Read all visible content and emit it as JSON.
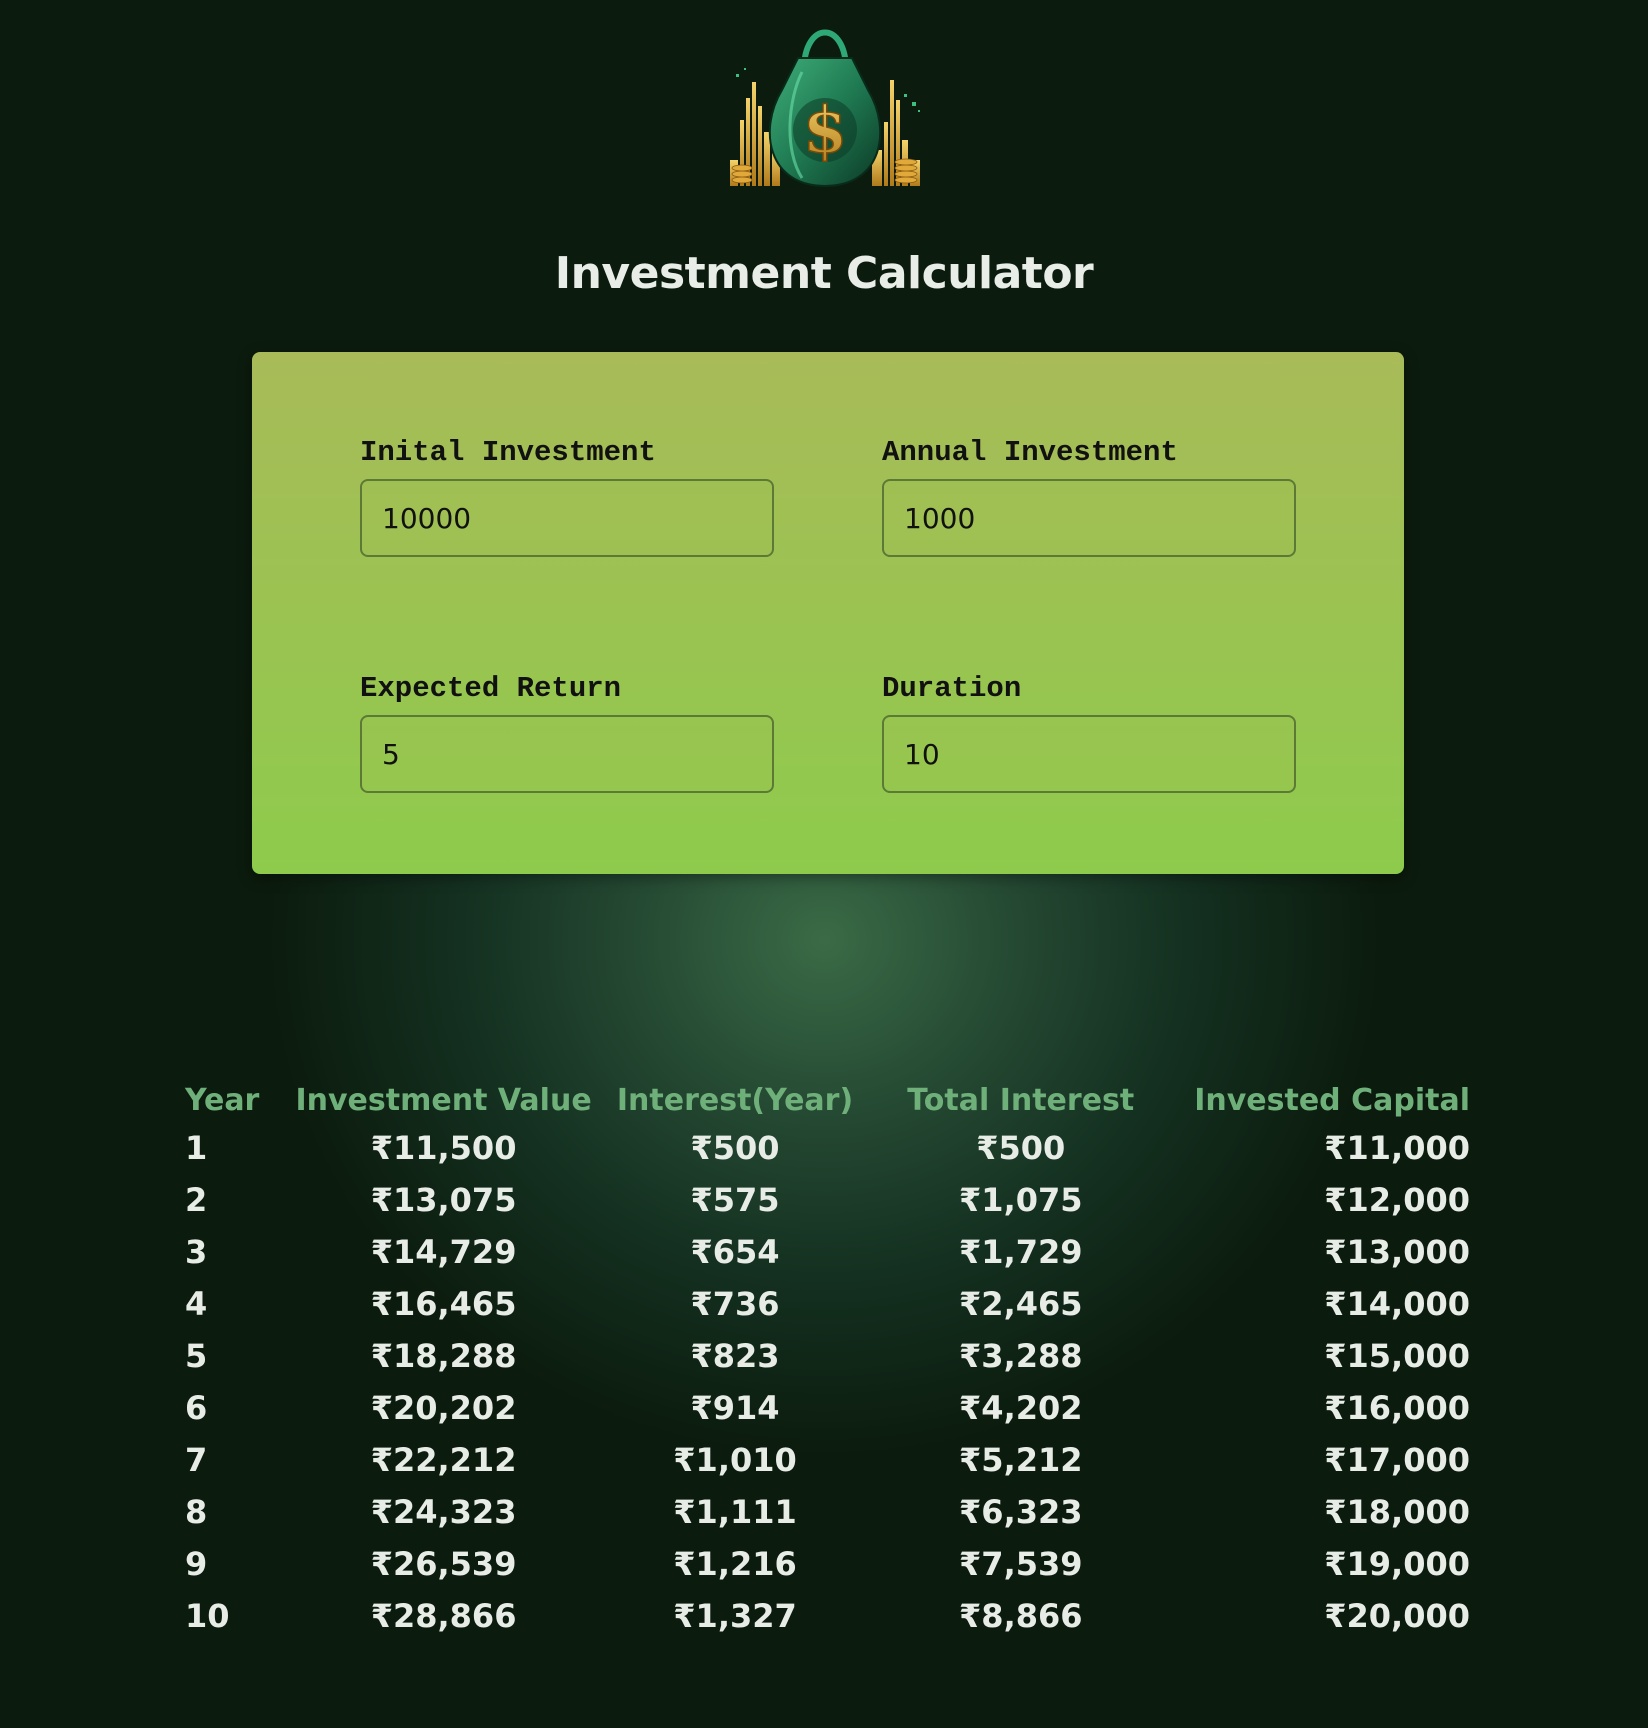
{
  "app": {
    "title": "Investment Calculator"
  },
  "form": {
    "initial_investment": {
      "label": "Inital Investment",
      "value": "10000"
    },
    "annual_investment": {
      "label": "Annual Investment",
      "value": "1000"
    },
    "expected_return": {
      "label": "Expected Return",
      "value": "5"
    },
    "duration": {
      "label": "Duration",
      "value": "10"
    }
  },
  "table": {
    "headers": [
      "Year",
      "Investment Value",
      "Interest(Year)",
      "Total Interest",
      "Invested Capital"
    ],
    "rows": [
      [
        "1",
        "₹11,500",
        "₹500",
        "₹500",
        "₹11,000"
      ],
      [
        "2",
        "₹13,075",
        "₹575",
        "₹1,075",
        "₹12,000"
      ],
      [
        "3",
        "₹14,729",
        "₹654",
        "₹1,729",
        "₹13,000"
      ],
      [
        "4",
        "₹16,465",
        "₹736",
        "₹2,465",
        "₹14,000"
      ],
      [
        "5",
        "₹18,288",
        "₹823",
        "₹3,288",
        "₹15,000"
      ],
      [
        "6",
        "₹20,202",
        "₹914",
        "₹4,202",
        "₹16,000"
      ],
      [
        "7",
        "₹22,212",
        "₹1,010",
        "₹5,212",
        "₹17,000"
      ],
      [
        "8",
        "₹24,323",
        "₹1,111",
        "₹6,323",
        "₹18,000"
      ],
      [
        "9",
        "₹26,539",
        "₹1,216",
        "₹7,539",
        "₹19,000"
      ],
      [
        "10",
        "₹28,866",
        "₹1,327",
        "₹8,866",
        "₹20,000"
      ]
    ]
  },
  "icons": {
    "logo": "money-bag-logo-icon"
  },
  "colors": {
    "background": "#0b1b0d",
    "card_top": "#a8bb58",
    "card_bottom": "#8ecb4c",
    "header_text": "#6fb07a",
    "body_text": "#e8ece6"
  }
}
